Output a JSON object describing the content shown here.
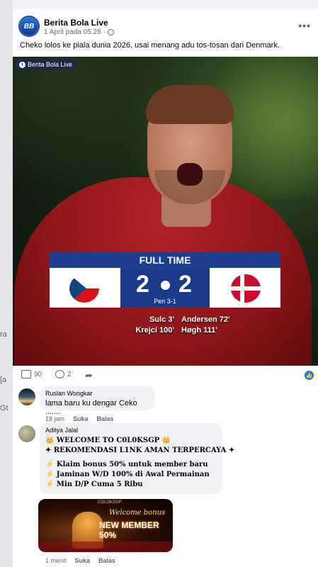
{
  "post": {
    "page_name": "Berita Bola Live",
    "timestamp": "1 April pada 05.28",
    "caption": "Cheko lolos ke piala dunia 2026, usai menang adu tos-tosan dari Denmark.",
    "more_label": "•••",
    "avatar_text": "BB"
  },
  "photo": {
    "tag": "Berita Bola Live",
    "banner": "FULL TIME",
    "score_left": "2",
    "score_right": "2",
    "penalty": "Pen 3-1",
    "scorers_left": [
      "Sulc 3'",
      "Krejcí 100'"
    ],
    "scorers_right": [
      "Andersen 72'",
      "Høgh 111'"
    ]
  },
  "reactions": {
    "likes": "90",
    "comments": "2"
  },
  "comments": [
    {
      "author": "Ruslan Wongkar",
      "text": "lama baru ku dengar Ceko .......",
      "time": "18 jam",
      "like": "Suka",
      "reply": "Balas"
    },
    {
      "author": "Aditya Jalal",
      "lines": [
        "👑 WELCOME TO C0L0KSGP 👑",
        "✦ REKOMENDASI L1NK AMAN TERPERCAYA ✦",
        "⚡ Klaim bonus 50% untuk member baru",
        "⚡ Jaminan W/D 100% di Awal Permainan",
        "⚡ Min D/P Cuma 5 Ribu"
      ],
      "time": "1 menit",
      "like": "Suka",
      "reply": "Balas",
      "promo_brand": "COLOKSGP",
      "promo_welcome": "Welcome bonus",
      "promo_new": "NEW MEMBER 50%"
    }
  ],
  "left_strip": [
    "ra",
    "[a",
    "Gt"
  ]
}
